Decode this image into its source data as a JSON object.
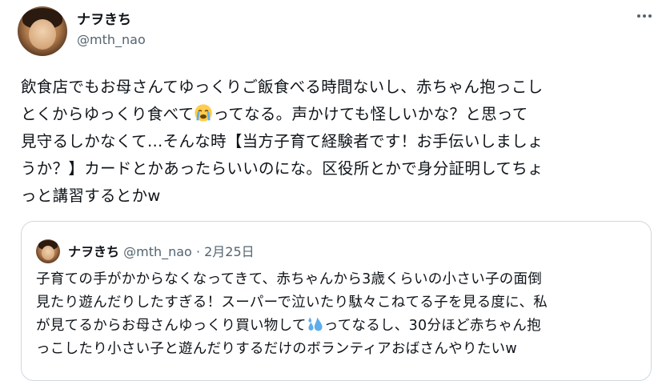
{
  "author": {
    "display_name": "ナヲきち",
    "handle": "@mth_nao"
  },
  "icons": {
    "more": "more-horizontal-icon",
    "crying_emoji": "loudly-crying-face-icon",
    "sweat_emoji": "sweat-droplets-icon"
  },
  "tweet": {
    "part1": "飲食店でもお母さんてゆっくりご飯食べる時間ないし、赤ちゃん抱っこし\nとくからゆっくり食べて",
    "part2": "ってなる。声かけても怪しいかな？と思って\n見守るしかなくて…そんな時【当方子育て経験者です！お手伝いしましょ\nうか？】カードとかあったらいいのにな。区役所とかで身分証明してちょ\nっと講習するとかw"
  },
  "quoted_tweet": {
    "display_name": "ナヲきち",
    "handle": "@mth_nao",
    "separator": "·",
    "date": "2月25日",
    "part1": "子育ての手がかからなくなってきて、赤ちゃんから3歳くらいの小さい子の面倒\n見たり遊んだりしたすぎる！スーパーで泣いたり駄々こねてる子を見る度に、私\nが見てるからお母さんゆっくり買い物して",
    "part2": "ってなるし、30分ほど赤ちゃん抱\nっこしたり小さい子と遊んだりするだけのボランティアおばさんやりたいw"
  },
  "colors": {
    "text": "#0f1419",
    "secondary": "#536471",
    "border": "#cfd9de"
  }
}
